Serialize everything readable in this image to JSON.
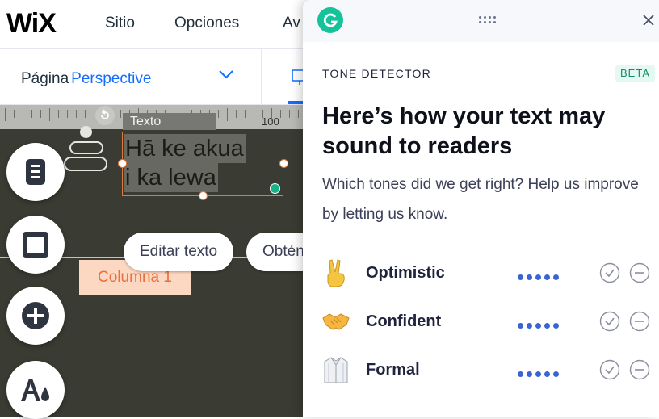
{
  "wix": {
    "logo": "WiX",
    "menu": [
      "Sitio",
      "Opciones",
      "Av"
    ],
    "page_label": "Página",
    "page_name": "Perspective",
    "ruler_label": "100",
    "text_tag": "Texto",
    "selected_text": [
      "Hā ke akua",
      "i ka lewa"
    ],
    "edit_text_button": "Editar texto",
    "obtain_button": "Obtén",
    "column_tag": "Columna 1"
  },
  "grammarly": {
    "section_label": "TONE DETECTOR",
    "beta_badge": "BETA",
    "headline": "Here’s how your text may sound to readers",
    "subtext": "Which tones did we get right? Help us improve by letting us know.",
    "tones": [
      {
        "name": "Optimistic",
        "emoji": "victory-hand-icon",
        "level": 5
      },
      {
        "name": "Confident",
        "emoji": "handshake-icon",
        "level": 5
      },
      {
        "name": "Formal",
        "emoji": "dress-shirt-icon",
        "level": 5
      }
    ],
    "colors": {
      "brand": "#15c39a",
      "dots": "#3a63d4",
      "wix_blue": "#116dff"
    }
  }
}
